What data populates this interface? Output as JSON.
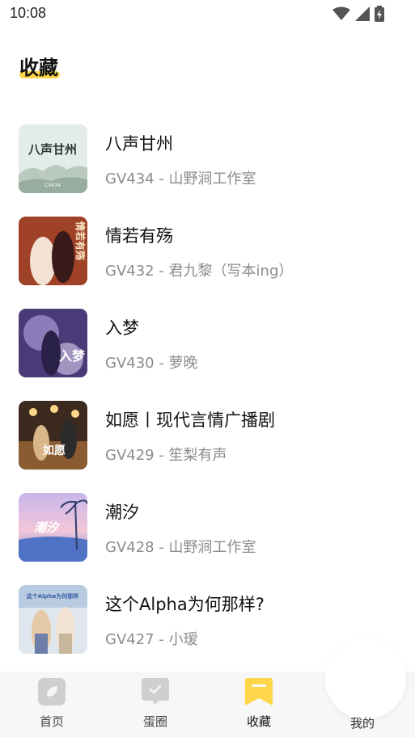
{
  "status_bar": {
    "time": "10:08",
    "icons": [
      "wifi-icon",
      "cell-signal-icon",
      "battery-charging-icon"
    ]
  },
  "page": {
    "title": "收藏"
  },
  "favorites": [
    {
      "title": "八声甘州",
      "subtitle": "GV434 - 山野涧工作室",
      "cover_text": "八声甘州",
      "cover_caption": "CV434"
    },
    {
      "title": "情若有殇",
      "subtitle": "GV432 - 君九黎（写本ing）",
      "cover_text": "情若有殇"
    },
    {
      "title": "入梦",
      "subtitle": "GV430 - 萝晚",
      "cover_text": "入梦"
    },
    {
      "title": "如愿丨现代言情广播剧",
      "subtitle": "GV429 - 笙梨有声",
      "cover_text": "如愿"
    },
    {
      "title": "潮汐",
      "subtitle": "GV428 - 山野涧工作室",
      "cover_text": "潮汐"
    },
    {
      "title": "这个Alpha为何那样?",
      "subtitle": "GV427 - 小瑷",
      "cover_text": "这个Alpha为何那样"
    }
  ],
  "tab_bar": {
    "tabs": [
      {
        "label": "首页",
        "icon": "leaf-icon",
        "active": false
      },
      {
        "label": "蛋圈",
        "icon": "chat-check-icon",
        "active": false
      },
      {
        "label": "收藏",
        "icon": "bookmark-icon",
        "active": true
      },
      {
        "label": "我的",
        "icon": "profile-icon",
        "active": false
      }
    ]
  },
  "colors": {
    "accent": "#FFD64A",
    "subtitle": "#8c8c8c",
    "tab_bg": "#f7f7f7"
  }
}
